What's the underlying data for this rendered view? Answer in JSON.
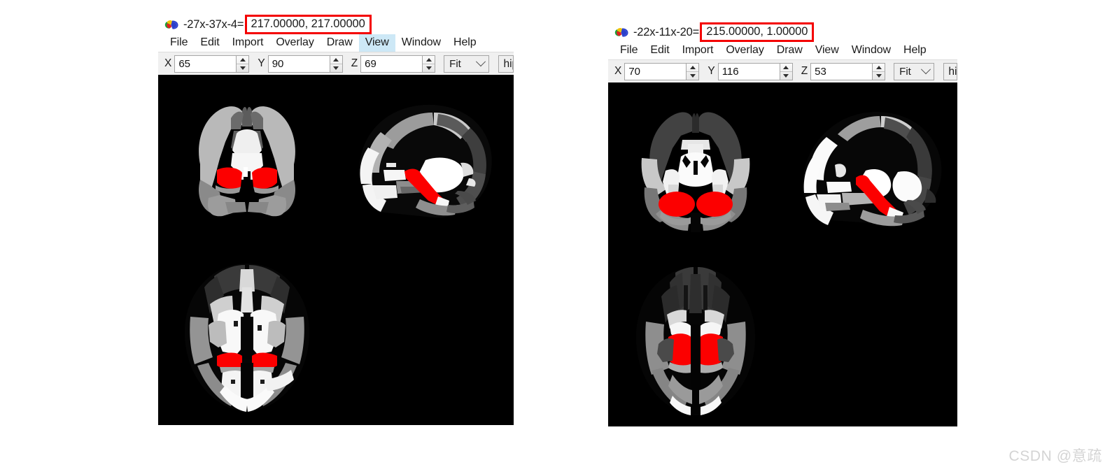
{
  "windows": [
    {
      "id": "window-left",
      "icon": "brain-icon",
      "title_coords": "-27x-37x-4",
      "title_equals": "=",
      "title_values": "217.00000, 217.00000",
      "menu": [
        {
          "label": "File",
          "active": false
        },
        {
          "label": "Edit",
          "active": false
        },
        {
          "label": "Import",
          "active": false
        },
        {
          "label": "Overlay",
          "active": false
        },
        {
          "label": "Draw",
          "active": false
        },
        {
          "label": "View",
          "active": true
        },
        {
          "label": "Window",
          "active": false
        },
        {
          "label": "Help",
          "active": false
        }
      ],
      "toolbar": {
        "x_label": "X",
        "x_value": "65",
        "y_label": "Y",
        "y_value": "90",
        "z_label": "Z",
        "z_value": "69",
        "zoom_mode": "Fit",
        "layer_name": "hip"
      }
    },
    {
      "id": "window-right",
      "icon": "brain-icon",
      "title_coords": "-22x-11x-20",
      "title_equals": "=",
      "title_values": "215.00000, 1.00000",
      "menu": [
        {
          "label": "File",
          "active": false
        },
        {
          "label": "Edit",
          "active": false
        },
        {
          "label": "Import",
          "active": false
        },
        {
          "label": "Overlay",
          "active": false
        },
        {
          "label": "Draw",
          "active": false
        },
        {
          "label": "View",
          "active": false
        },
        {
          "label": "Window",
          "active": false
        },
        {
          "label": "Help",
          "active": false
        }
      ],
      "toolbar": {
        "x_label": "X",
        "x_value": "70",
        "y_label": "Y",
        "y_value": "116",
        "z_label": "Z",
        "z_value": "53",
        "zoom_mode": "Fit",
        "layer_name": "hip"
      }
    }
  ],
  "colors": {
    "highlight_box": "#f40000",
    "overlay_red": "#fc0000",
    "menu_active_bg": "#cde8f6",
    "toolbar_bg": "#f0f0f0",
    "canvas_bg": "#000000"
  },
  "watermark": "CSDN @意疏"
}
